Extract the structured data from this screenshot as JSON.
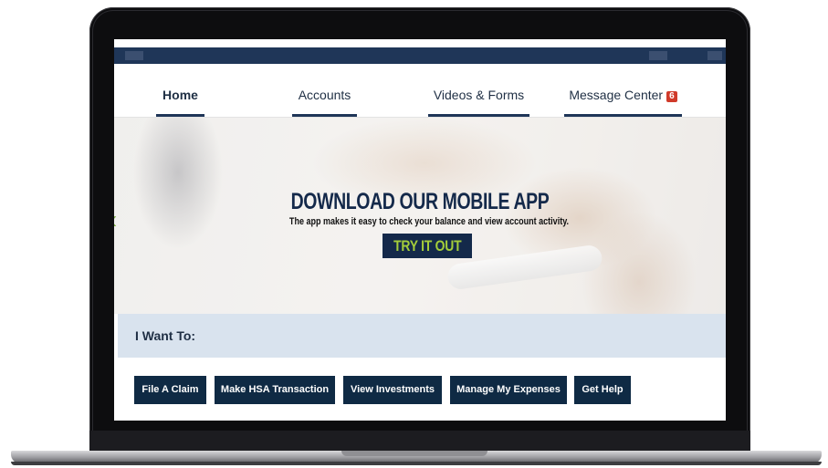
{
  "nav": {
    "tabs": [
      {
        "label": "Home",
        "active": true
      },
      {
        "label": "Accounts",
        "active": false
      },
      {
        "label": "Videos & Forms",
        "active": false
      },
      {
        "label": "Message Center",
        "active": false,
        "badge": "6"
      }
    ]
  },
  "hero": {
    "title": "DOWNLOAD OUR MOBILE APP",
    "subtitle": "The app makes it easy to check your balance and view account activity.",
    "cta_label": "TRY IT OUT",
    "prev_icon": "chevron-left-icon"
  },
  "i_want": {
    "label": "I Want To:"
  },
  "actions": [
    {
      "label": "File A Claim"
    },
    {
      "label": "Make HSA Transaction"
    },
    {
      "label": "View Investments"
    },
    {
      "label": "Manage My Expenses"
    },
    {
      "label": "Get Help"
    }
  ],
  "colors": {
    "navy": "#1f3658",
    "button_navy": "#0f2a44",
    "cta_green": "#a4cd3a",
    "badge_red": "#d03a2a",
    "band_blue": "#d9e3ee"
  }
}
